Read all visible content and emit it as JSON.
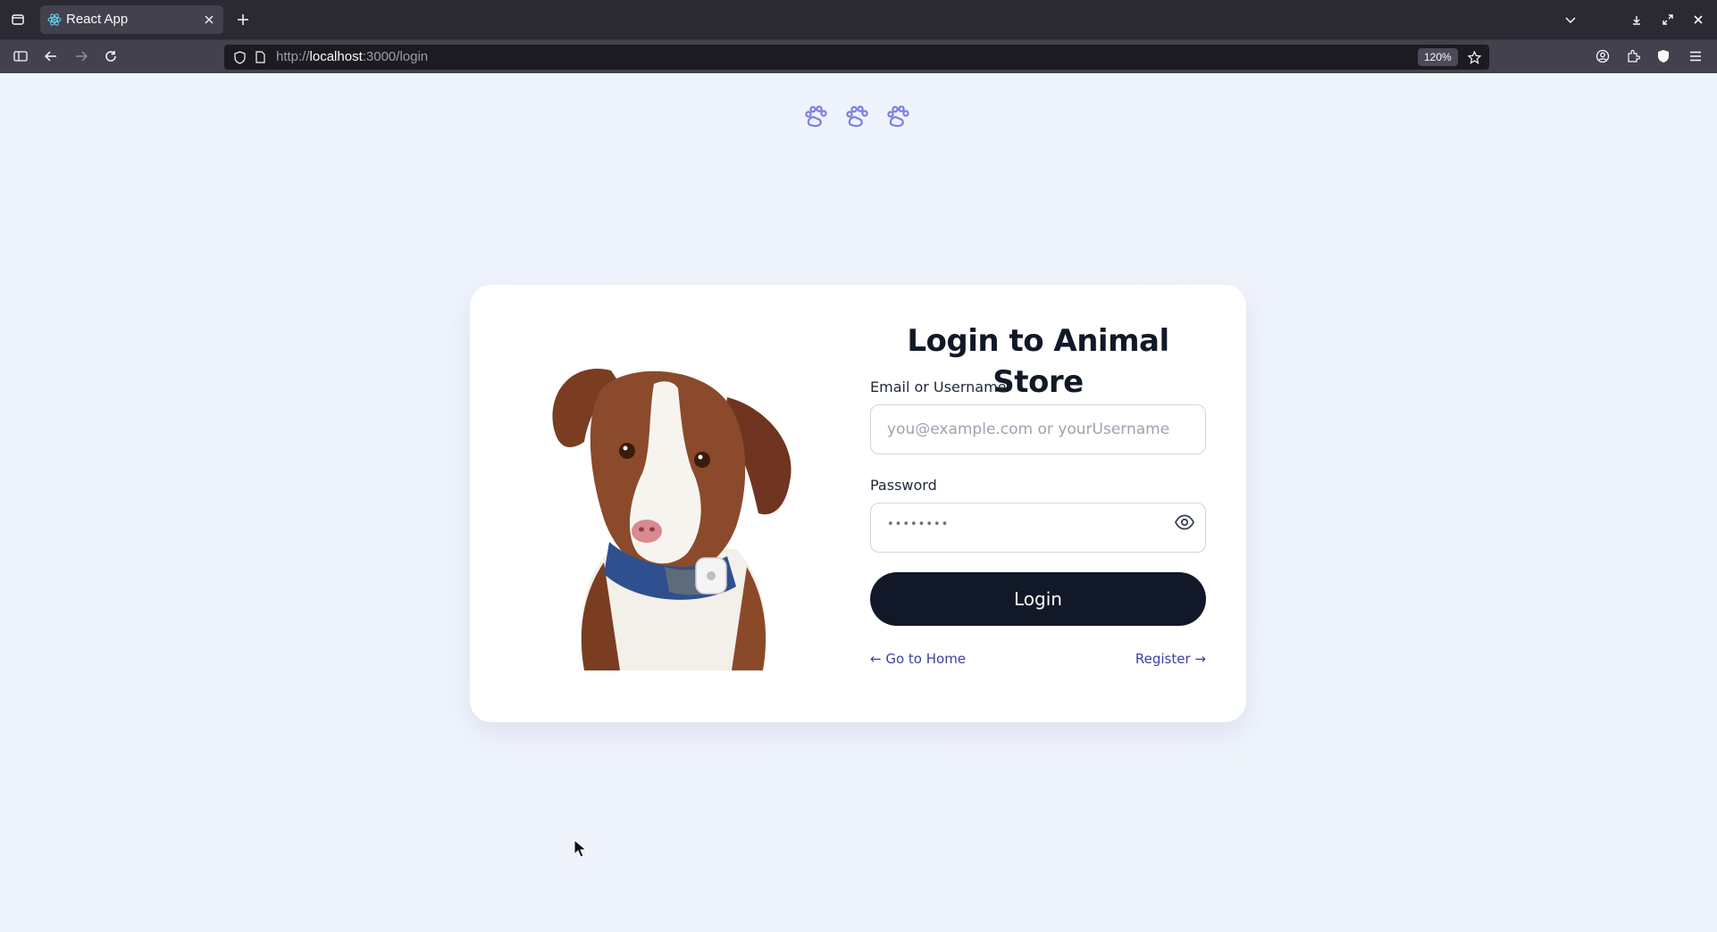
{
  "browser": {
    "tab_title": "React App",
    "url_scheme": "http://",
    "url_host": "localhost",
    "url_path": ":3000/login",
    "zoom_level": "120%"
  },
  "icons": {
    "paw": "paw-icon",
    "eye": "eye-icon"
  },
  "colors": {
    "accent": "#7c7fe0",
    "button": "#111827",
    "link": "#3b3ea8",
    "background": "#eef3fd"
  },
  "login": {
    "title": "Login to Animal Store",
    "email_label": "Email or Username",
    "email_placeholder": "you@example.com or yourUsername",
    "email_value": "",
    "password_label": "Password",
    "password_dots": "••••••••",
    "login_button": "Login",
    "home_link": "← Go to Home",
    "register_link": "Register →"
  }
}
